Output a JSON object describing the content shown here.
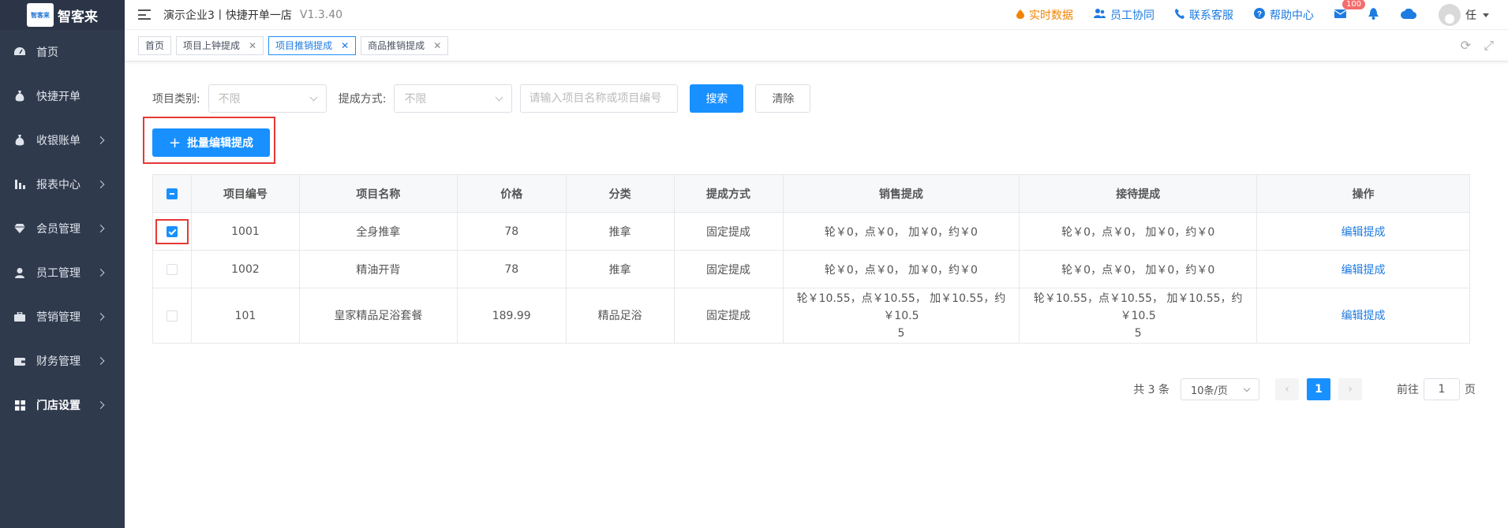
{
  "sidebar": {
    "logo_badge": "智客来",
    "logo_text": "智客来",
    "items": [
      {
        "label": "首页",
        "icon": "dashboard-icon",
        "has_arrow": false
      },
      {
        "label": "快捷开单",
        "icon": "money-bag-icon",
        "has_arrow": false
      },
      {
        "label": "收银账单",
        "icon": "money-bag-icon",
        "has_arrow": true
      },
      {
        "label": "报表中心",
        "icon": "bar-chart-icon",
        "has_arrow": true
      },
      {
        "label": "会员管理",
        "icon": "diamond-icon",
        "has_arrow": true
      },
      {
        "label": "员工管理",
        "icon": "user-icon",
        "has_arrow": true
      },
      {
        "label": "营销管理",
        "icon": "briefcase-icon",
        "has_arrow": true
      },
      {
        "label": "财务管理",
        "icon": "wallet-icon",
        "has_arrow": true
      },
      {
        "label": "门店设置",
        "icon": "grid-icon",
        "has_arrow": true
      }
    ]
  },
  "header": {
    "company": "演示企业3丨快捷开单一店",
    "version": "V1.3.40",
    "links": {
      "realtime": "实时数据",
      "staff": "员工协同",
      "support": "联系客服",
      "help": "帮助中心"
    },
    "mail_badge": "100",
    "user": "任"
  },
  "tabs": [
    {
      "label": "首页",
      "closable": false
    },
    {
      "label": "项目上钟提成",
      "closable": true
    },
    {
      "label": "项目推销提成",
      "closable": true,
      "active": true
    },
    {
      "label": "商品推销提成",
      "closable": true
    }
  ],
  "filters": {
    "category_label": "项目类别:",
    "category_value": "不限",
    "method_label": "提成方式:",
    "method_value": "不限",
    "search_placeholder": "请输入项目名称或项目编号",
    "search_button": "搜索",
    "clear_button": "清除"
  },
  "batch_button": "批量编辑提成",
  "table": {
    "headers": [
      "项目编号",
      "项目名称",
      "价格",
      "分类",
      "提成方式",
      "销售提成",
      "接待提成",
      "操作"
    ],
    "rows": [
      {
        "checked": true,
        "code": "1001",
        "name": "全身推拿",
        "price": "78",
        "category": "推拿",
        "method": "固定提成",
        "sales_line1": "轮￥0，点￥0， 加￥0，约￥0",
        "sales_line2": "",
        "reception_line1": "轮￥0，点￥0， 加￥0，约￥0",
        "reception_line2": "",
        "action": "编辑提成"
      },
      {
        "checked": false,
        "code": "1002",
        "name": "精油开背",
        "price": "78",
        "category": "推拿",
        "method": "固定提成",
        "sales_line1": "轮￥0，点￥0， 加￥0，约￥0",
        "sales_line2": "",
        "reception_line1": "轮￥0，点￥0， 加￥0，约￥0",
        "reception_line2": "",
        "action": "编辑提成"
      },
      {
        "checked": false,
        "code": "101",
        "name": "皇家精品足浴套餐",
        "price": "189.99",
        "category": "精品足浴",
        "method": "固定提成",
        "sales_line1": "轮￥10.55，点￥10.55， 加￥10.55，约￥10.5",
        "sales_line2": "5",
        "reception_line1": "轮￥10.55，点￥10.55， 加￥10.55，约￥10.5",
        "reception_line2": "5",
        "action": "编辑提成"
      }
    ]
  },
  "pagination": {
    "total": "共 3 条",
    "page_size": "10条/页",
    "current_page": "1",
    "goto_prefix": "前往",
    "goto_value": "1",
    "goto_suffix": "页"
  },
  "colors": {
    "primary": "#1890ff",
    "sidebar_bg": "#2f3a4d",
    "highlight_border": "#e53935",
    "orange_link": "#f08300"
  }
}
